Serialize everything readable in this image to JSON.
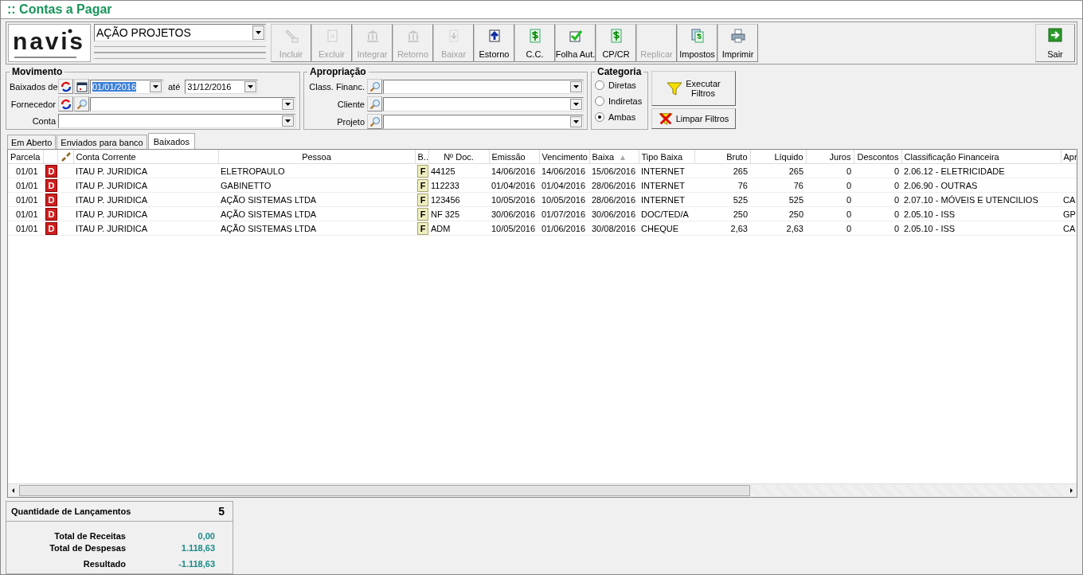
{
  "window": {
    "title": ":: Contas a Pagar"
  },
  "logo": {
    "text": "navis"
  },
  "company": {
    "value": "AÇÃO PROJETOS"
  },
  "toolbar": [
    {
      "label": "Incluir",
      "kind": "pencil",
      "disabled": true
    },
    {
      "label": "Excluir",
      "kind": "delete",
      "disabled": true
    },
    {
      "label": "Integrar",
      "kind": "bank",
      "disabled": true
    },
    {
      "label": "Retorno",
      "kind": "bank",
      "disabled": true
    },
    {
      "label": "Baixar",
      "kind": "down",
      "disabled": true
    },
    {
      "label": "Estorno",
      "kind": "up",
      "disabled": false
    },
    {
      "label": "C.C.",
      "kind": "dollar",
      "disabled": false
    },
    {
      "label": "Folha Aut.",
      "kind": "check",
      "disabled": false
    },
    {
      "label": "CP/CR",
      "kind": "dollar",
      "disabled": false
    },
    {
      "label": "Replicar",
      "kind": "plain",
      "disabled": true
    },
    {
      "label": "Impostos",
      "kind": "stack",
      "disabled": false
    },
    {
      "label": "Imprimir",
      "kind": "printer",
      "disabled": false
    }
  ],
  "exit_button": {
    "label": "Sair"
  },
  "movimento": {
    "title": "Movimento",
    "date_label": "Baixados de",
    "date_from": "01/01/2016",
    "date_to_label": "até",
    "date_to": "31/12/2016",
    "supplier_label": "Fornecedor",
    "account_label": "Conta"
  },
  "apropriacao": {
    "title": "Apropriação",
    "fields": [
      {
        "label": "Class. Financ."
      },
      {
        "label": "Cliente"
      },
      {
        "label": "Projeto"
      }
    ]
  },
  "categoria": {
    "title": "Categoria",
    "options": [
      {
        "label": "Diretas",
        "selected": false
      },
      {
        "label": "Indiretas",
        "selected": false
      },
      {
        "label": "Ambas",
        "selected": true
      }
    ]
  },
  "filter_buttons": {
    "run": [
      "Executar",
      "Filtros"
    ],
    "clear": "Limpar Filtros"
  },
  "tabs": [
    {
      "label": "Em Aberto",
      "selected": false
    },
    {
      "label": "Enviados para banco",
      "selected": false
    },
    {
      "label": "Baixados",
      "selected": true
    }
  ],
  "table": {
    "columns": [
      "Parcela",
      "",
      "",
      "Conta Corrente",
      "Pessoa",
      "B..",
      "Nº Doc.",
      "Emissão",
      "Vencimento",
      "Baixa",
      "Tipo Baixa",
      "Bruto",
      "Líquido",
      "Juros",
      "Descontos",
      "Classificação Financeira",
      "Apr"
    ],
    "rows": [
      [
        "01/01",
        "D",
        "",
        "ITAU P. JURIDICA",
        "ELETROPAULO",
        "F",
        "44125",
        "14/06/2016",
        "14/06/2016",
        "15/06/2016",
        "INTERNET",
        "265",
        "265",
        "0",
        "0",
        "2.06.12 - ELETRICIDADE",
        ""
      ],
      [
        "01/01",
        "D",
        "",
        "ITAU P. JURIDICA",
        "GABINETTO",
        "F",
        "112233",
        "01/04/2016",
        "01/04/2016",
        "28/06/2016",
        "INTERNET",
        "76",
        "76",
        "0",
        "0",
        "2.06.90 - OUTRAS",
        ""
      ],
      [
        "01/01",
        "D",
        "",
        "ITAU P. JURIDICA",
        "AÇÃO SISTEMAS LTDA",
        "F",
        "123456",
        "10/05/2016",
        "10/05/2016",
        "28/06/2016",
        "INTERNET",
        "525",
        "525",
        "0",
        "0",
        "2.07.10 - MÓVEIS E UTENCILIOS",
        "CA"
      ],
      [
        "01/01",
        "D",
        "",
        "ITAU P. JURIDICA",
        "AÇÃO SISTEMAS LTDA",
        "F",
        "NF 325",
        "30/06/2016",
        "01/07/2016",
        "30/06/2016",
        "DOC/TED/A",
        "250",
        "250",
        "0",
        "0",
        "2.05.10 - ISS",
        "GP"
      ],
      [
        "01/01",
        "D",
        "",
        "ITAU P. JURIDICA",
        "AÇÃO SISTEMAS LTDA",
        "F",
        "ADM",
        "10/05/2016",
        "01/06/2016",
        "30/08/2016",
        "CHEQUE",
        "2,63",
        "2,63",
        "0",
        "0",
        "2.05.10 - ISS",
        "CA"
      ]
    ]
  },
  "summary": {
    "count_label": "Quantidade de Lançamentos",
    "count": "5",
    "totals": [
      {
        "label": "Total de Receitas",
        "value": "0,00"
      },
      {
        "label": "Total de Despesas",
        "value": "1.118,63"
      },
      {
        "label": "Resultado",
        "value": "-1.118,63"
      }
    ]
  }
}
